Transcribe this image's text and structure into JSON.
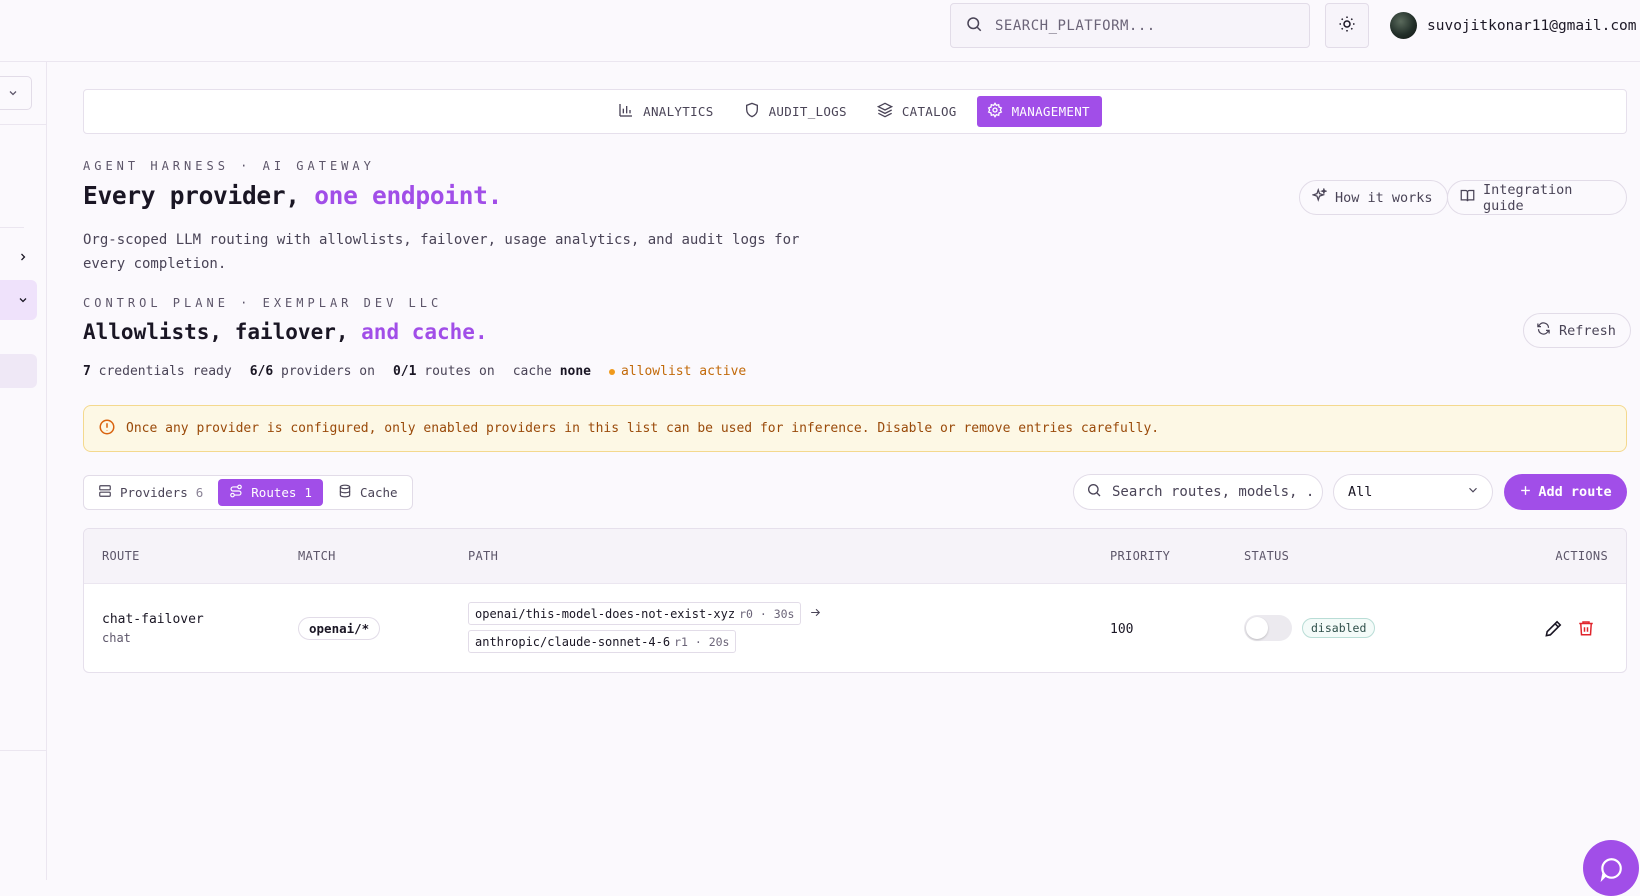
{
  "header": {
    "search_placeholder": "SEARCH_PLATFORM...",
    "user_email": "suvojitkonar11@gmail.com"
  },
  "nav": {
    "tabs": [
      {
        "label": "ANALYTICS",
        "icon": "bar-chart-icon",
        "active": false
      },
      {
        "label": "AUDIT_LOGS",
        "icon": "shield-icon",
        "active": false
      },
      {
        "label": "CATALOG",
        "icon": "layers-icon",
        "active": false
      },
      {
        "label": "MANAGEMENT",
        "icon": "gear-icon",
        "active": true
      }
    ]
  },
  "hero": {
    "eyebrow": "AGENT HARNESS · AI GATEWAY",
    "title_plain": "Every provider, ",
    "title_accent": "one endpoint.",
    "description": "Org-scoped LLM routing with allowlists, failover, usage analytics, and audit logs for every completion.",
    "how_it_works": "How it works",
    "integration_guide": "Integration guide"
  },
  "control": {
    "eyebrow": "CONTROL PLANE · EXEMPLAR DEV LLC",
    "title_plain": "Allowlists, failover, ",
    "title_accent": "and cache.",
    "refresh": "Refresh",
    "stats": {
      "credentials_value": "7",
      "credentials_label": "credentials ready",
      "providers_value": "6/6",
      "providers_label": "providers on",
      "routes_value": "0/1",
      "routes_label": "routes on",
      "cache_label": "cache",
      "cache_value": "none",
      "allowlist": "allowlist active"
    }
  },
  "alert": {
    "text": "Once any provider is configured, only enabled providers in this list can be used for inference. Disable or remove entries carefully."
  },
  "toolbar": {
    "segments": [
      {
        "label": "Providers",
        "count": "6",
        "active": false
      },
      {
        "label": "Routes",
        "count": "1",
        "active": true
      },
      {
        "label": "Cache",
        "count": "",
        "active": false
      }
    ],
    "search_placeholder": "Search routes, models, ...",
    "filter_value": "All",
    "add_route": "Add route"
  },
  "table": {
    "columns": {
      "route": "ROUTE",
      "match": "MATCH",
      "path": "PATH",
      "priority": "PRIORITY",
      "status": "STATUS",
      "actions": "ACTIONS"
    },
    "rows": [
      {
        "name": "chat-failover",
        "type": "chat",
        "match": "openai/*",
        "path": [
          {
            "model": "openai/this-model-does-not-exist-xyz",
            "meta": "r0 · 30s"
          },
          {
            "model": "anthropic/claude-sonnet-4-6",
            "meta": "r1 · 20s"
          }
        ],
        "priority": "100",
        "enabled": false,
        "status": "disabled"
      }
    ]
  },
  "colors": {
    "accent": "#a14ee8",
    "warning_text": "#9a4a0a",
    "warning_bg": "#fdf8e5",
    "danger": "#e0242c"
  }
}
